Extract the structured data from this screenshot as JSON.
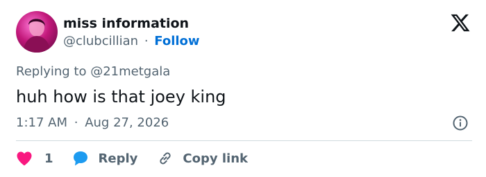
{
  "author": {
    "display_name": "miss information",
    "handle": "@clubcillian",
    "separator": "·",
    "follow_label": "Follow"
  },
  "reply_context": {
    "prefix": "Replying to",
    "mention": "@21metgala"
  },
  "tweet": {
    "text": "huh how is that joey king",
    "time": "1:17 AM",
    "separator": "·",
    "date": "Aug 27, 2026"
  },
  "actions": {
    "like_count": "1",
    "reply_label": "Reply",
    "copy_label": "Copy link"
  },
  "icons": {
    "logo": "x-logo-icon",
    "info": "info-icon",
    "like": "heart-icon",
    "reply": "speech-bubble-icon",
    "copy": "link-icon"
  },
  "colors": {
    "like": "#f91880",
    "reply": "#1d9bf0",
    "follow": "#006fd6",
    "secondary_text": "#536471"
  }
}
